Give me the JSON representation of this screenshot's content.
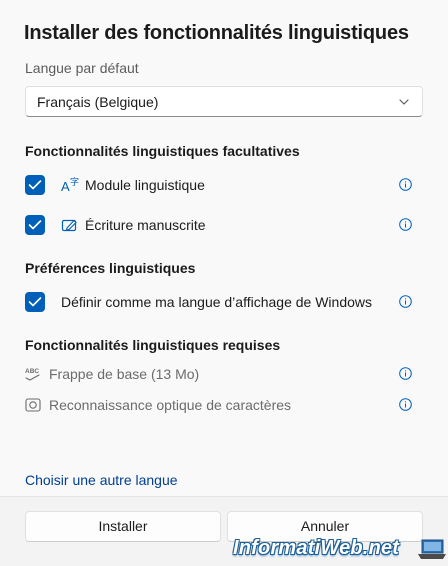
{
  "dialog": {
    "title": "Installer des fonctionnalités linguistiques",
    "default_language_label": "Langue par défaut",
    "default_language_value": "Français (Belgique)"
  },
  "optional_features": {
    "heading": "Fonctionnalités linguistiques facultatives",
    "items": [
      {
        "label": "Module linguistique",
        "checked": true,
        "icon": "language-pack-icon"
      },
      {
        "label": "Écriture manuscrite",
        "checked": true,
        "icon": "handwriting-icon"
      }
    ]
  },
  "preferences": {
    "heading": "Préférences linguistiques",
    "items": [
      {
        "label": "Définir comme ma langue d’affichage de Windows",
        "checked": true
      }
    ]
  },
  "required_features": {
    "heading": "Fonctionnalités linguistiques requises",
    "items": [
      {
        "label": "Frappe de base (13 Mo)",
        "icon": "basic-typing-icon"
      },
      {
        "label": "Reconnaissance optique de caractères",
        "icon": "ocr-icon"
      }
    ]
  },
  "link": {
    "label": "Choisir une autre langue"
  },
  "footer": {
    "install_label": "Installer",
    "cancel_label": "Annuler"
  },
  "watermark": {
    "text": "InformatiWeb.net"
  },
  "colors": {
    "accent": "#005fb8",
    "link": "#003e92"
  }
}
